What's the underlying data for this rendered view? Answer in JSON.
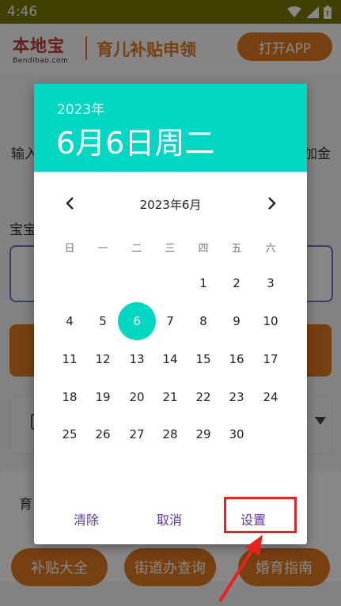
{
  "status_bar": {
    "time": "4:46"
  },
  "header": {
    "logo_main": "本地宝",
    "logo_sub": "Bendibao.com",
    "title": "育儿补贴申领",
    "open_app_button": "打开APP"
  },
  "background_page": {
    "partial_text_left": "输入",
    "partial_text_right": "加金",
    "partial_label_baby": "宝宝",
    "partial_label_section": "育",
    "bottom_buttons": [
      "补贴大全",
      "街道办查询",
      "婚育指南"
    ]
  },
  "date_picker": {
    "header_year": "2023年",
    "header_date": "6月6日周二",
    "month_title": "2023年6月",
    "weekdays": [
      "日",
      "一",
      "二",
      "三",
      "四",
      "五",
      "六"
    ],
    "days": [
      "1",
      "2",
      "3",
      "4",
      "5",
      "6",
      "7",
      "8",
      "9",
      "10",
      "11",
      "12",
      "13",
      "14",
      "15",
      "16",
      "17",
      "18",
      "19",
      "20",
      "21",
      "22",
      "23",
      "24",
      "25",
      "26",
      "27",
      "28",
      "29",
      "30"
    ],
    "selected_day": "6",
    "buttons": {
      "clear": "清除",
      "cancel": "取消",
      "set": "设置"
    }
  },
  "colors": {
    "accent_teal": "#00d8c4",
    "brand_orange": "#e07a20",
    "button_text_purple": "#5e35b1",
    "annotation_red": "#e8231d"
  }
}
